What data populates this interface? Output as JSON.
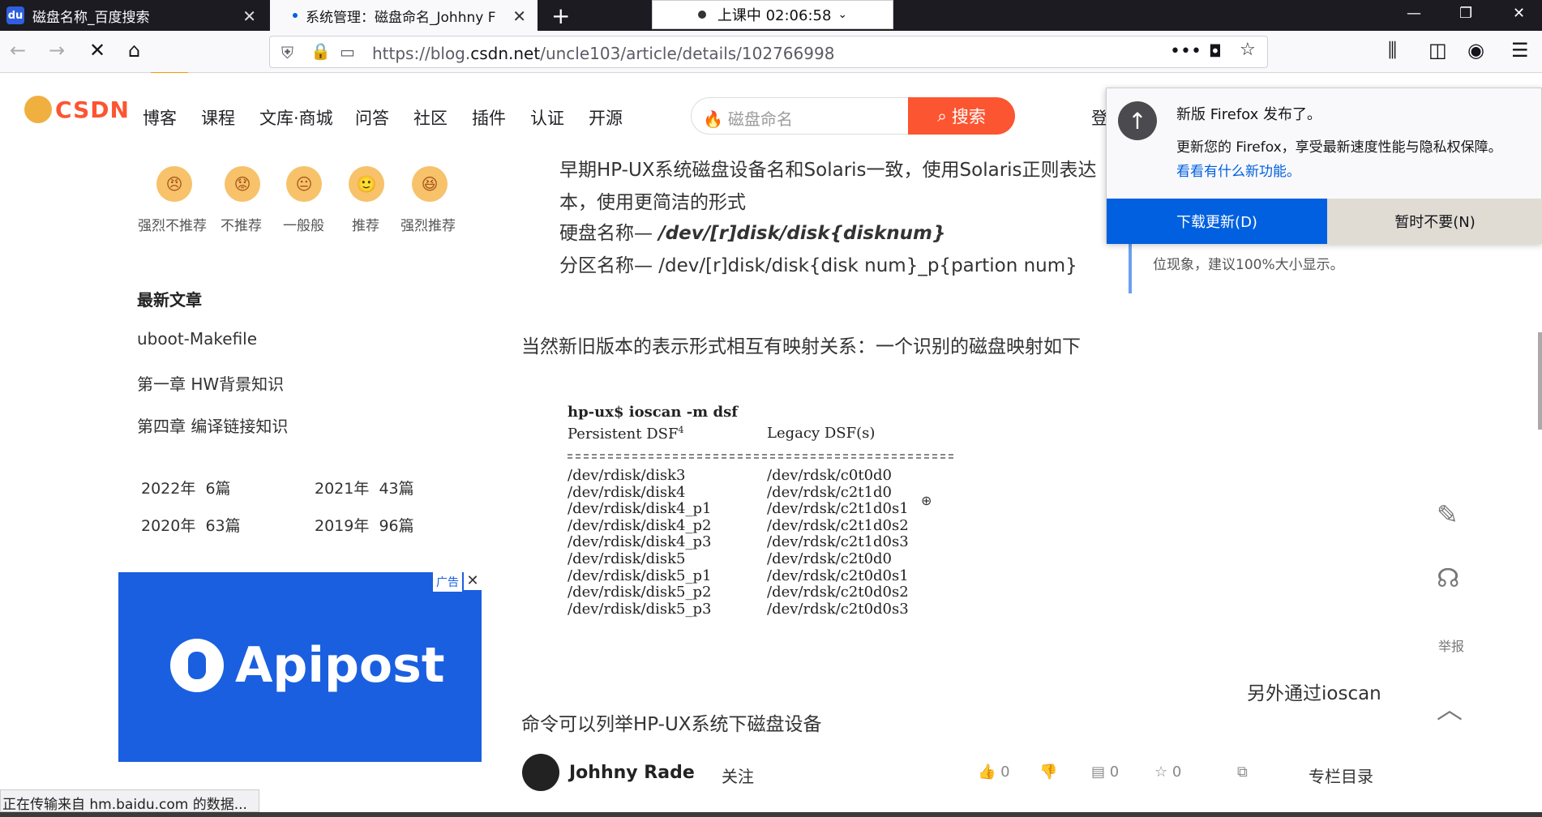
{
  "tabs": [
    {
      "title": "磁盘名称_百度搜索",
      "favicon": "du"
    },
    {
      "title": "系统管理：磁盘命名_Johhny F"
    }
  ],
  "recording": {
    "label": "上课中 02:06:58"
  },
  "url": {
    "prefix": "https://blog.",
    "domain": "csdn.net",
    "path": "/uncle103/article/details/102766998"
  },
  "header": {
    "logo": "CSDN",
    "nav": [
      "博客",
      "课程",
      "文库·商城",
      "问答",
      "社区",
      "插件",
      "认证",
      "开源"
    ],
    "search_placeholder": "磁盘命名",
    "search_button": "搜索",
    "login_fragment": "登"
  },
  "ratings": [
    "强烈不推荐",
    "不推荐",
    "一般般",
    "推荐",
    "强烈推荐"
  ],
  "sidebar": {
    "latest_title": "最新文章",
    "latest": [
      "uboot-Makefile",
      "第一章 HW背景知识",
      "第四章 编译链接知识"
    ],
    "archive": [
      {
        "year": "2022年",
        "count": "6篇"
      },
      {
        "year": "2021年",
        "count": "43篇"
      },
      {
        "year": "2020年",
        "count": "63篇"
      },
      {
        "year": "2019年",
        "count": "96篇"
      }
    ]
  },
  "ad": {
    "tag": "广告",
    "brand": "Apipost"
  },
  "article": {
    "p1": "早期HP-UX系统磁盘设备名和Solaris一致，使用Solaris正则表达",
    "p2": "本，使用更简洁的形式",
    "p3_label": "硬盘名称— ",
    "p3_value": "/dev/[r]disk/disk{disknum}",
    "p4": "分区名称— /dev/[r]disk/disk{disk num}_p{partion num}",
    "p5": "当然新旧版本的表示形式相互有映射关系：一个识别的磁盘映射如下",
    "p6": "另外通过ioscan",
    "p7": "命令可以列举HP-UX系统下磁盘设备"
  },
  "code": {
    "cmd": "hp-ux$ ioscan -m dsf",
    "h1": "Persistent DSF",
    "h1_sup": "4",
    "h2": "Legacy DSF(s)",
    "rows": [
      [
        "/dev/rdisk/disk3",
        "/dev/rdsk/c0t0d0"
      ],
      [
        "/dev/rdisk/disk4",
        "/dev/rdsk/c2t1d0"
      ],
      [
        "/dev/rdisk/disk4_p1",
        "/dev/rdsk/c2t1d0s1"
      ],
      [
        "/dev/rdisk/disk4_p2",
        "/dev/rdsk/c2t1d0s2"
      ],
      [
        "/dev/rdisk/disk4_p3",
        "/dev/rdsk/c2t1d0s3"
      ],
      [
        "/dev/rdisk/disk5",
        "/dev/rdsk/c2t0d0"
      ],
      [
        "/dev/rdisk/disk5_p1",
        "/dev/rdsk/c2t0d0s1"
      ],
      [
        "/dev/rdisk/disk5_p2",
        "/dev/rdsk/c2t0d0s2"
      ],
      [
        "/dev/rdisk/disk5_p3",
        "/dev/rdsk/c2t0d0s3"
      ]
    ]
  },
  "popup": {
    "title": "新版 Firefox 发布了。",
    "body": "更新您的 Firefox，享受最新速度性能与隐私权保障。",
    "link": "看看有什么新功能。",
    "download": "下载更新(D)",
    "later": "暂时不要(N)"
  },
  "notice": "位现象，建议100%大小显示。",
  "tools": {
    "report": "举报"
  },
  "footer": {
    "author": "Johhny Rade",
    "follow": "关注",
    "likes": "0",
    "comments": "0",
    "favorites": "0",
    "toc": "专栏目录"
  },
  "status": "正在传输来自 hm.baidu.com 的数据..."
}
